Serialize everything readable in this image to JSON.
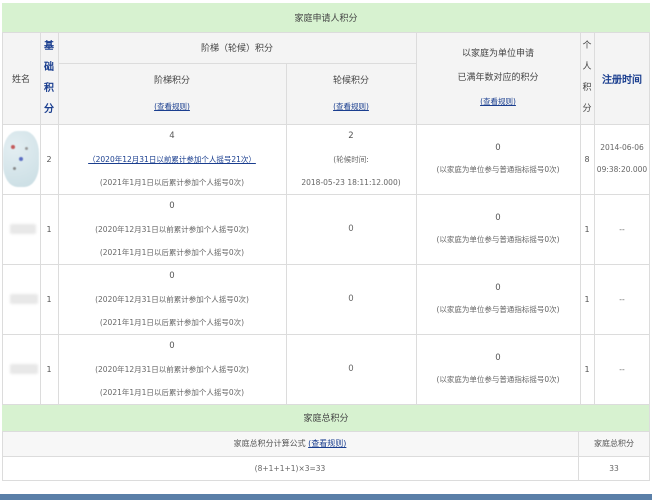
{
  "title_bar": "家庭申请人积分",
  "headers": {
    "name": "姓名",
    "base_points": [
      "基",
      "础",
      "积",
      "分"
    ],
    "ladder_group": "阶梯（轮候）积分",
    "ladder_points": "阶梯积分",
    "queue_points": "轮候积分",
    "family_unit": [
      "以家庭为单位申请",
      "已满年数对应的积分"
    ],
    "personal_points": [
      "个",
      "人",
      "积",
      "分"
    ],
    "register_time": "注册时间",
    "view_rules": "(查看规则)"
  },
  "rows": [
    {
      "base": "2",
      "ladder_value": "4",
      "ladder_link": "（2020年12月31日以前累计参加个人摇号21次）",
      "ladder_note": "(2021年1月1日以后累计参加个人摇号0次)",
      "queue_value": "2",
      "queue_label": "(轮候时间:",
      "queue_time": "2018-05-23 18:11:12.000)",
      "family_value": "0",
      "family_note": "(以家庭为单位参与普通指标摇号0次)",
      "personal": "8",
      "register_date": "2014-06-06",
      "register_time": "09:38:20.000"
    },
    {
      "base": "1",
      "ladder_value": "0",
      "ladder_note1": "(2020年12月31日以前累计参加个人摇号0次)",
      "ladder_note": "(2021年1月1日以后累计参加个人摇号0次)",
      "queue_value": "0",
      "family_value": "0",
      "family_note": "(以家庭为单位参与普通指标摇号0次)",
      "personal": "1",
      "register": "--"
    },
    {
      "base": "1",
      "ladder_value": "0",
      "ladder_note1": "(2020年12月31日以前累计参加个人摇号0次)",
      "ladder_note": "(2021年1月1日以后累计参加个人摇号0次)",
      "queue_value": "0",
      "family_value": "0",
      "family_note": "(以家庭为单位参与普通指标摇号0次)",
      "personal": "1",
      "register": "--"
    },
    {
      "base": "1",
      "ladder_value": "0",
      "ladder_note1": "(2020年12月31日以前累计参加个人摇号0次)",
      "ladder_note": "(2021年1月1日以后累计参加个人摇号0次)",
      "queue_value": "0",
      "family_value": "0",
      "family_note": "(以家庭为单位参与普通指标摇号0次)",
      "personal": "1",
      "register": "--"
    }
  ],
  "total": {
    "title": "家庭总积分",
    "formula_label": "家庭总积分计算公式",
    "view_rules": "(查看规则)",
    "total_label": "家庭总积分",
    "formula": "(8+1+1+1)×3=33",
    "total_value": "33"
  }
}
